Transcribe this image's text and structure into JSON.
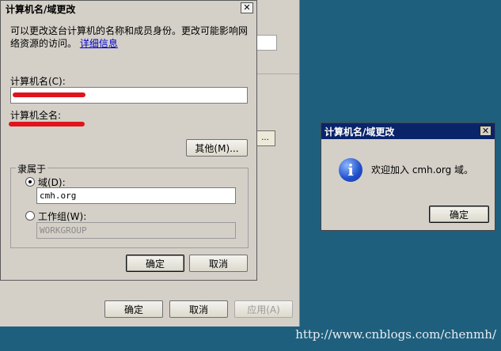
{
  "parent_window": {
    "ok_label": "确定",
    "cancel_label": "取消",
    "apply_label": "应用(A)",
    "small_button_label": "..."
  },
  "dialog": {
    "title": "计算机名/域更改",
    "close_glyph": "✕",
    "description": "可以更改这台计算机的名称和成员身份。更改可能影响网络资源的访问。",
    "details_link": "详细信息",
    "computer_name_label": "计算机名(C):",
    "computer_name_value": "",
    "full_name_label": "计算机全名:",
    "more_button": "其他(M)...",
    "member_of_label": "隶属于",
    "domain_label": "域(D):",
    "domain_value": "cmh.org",
    "workgroup_label": "工作组(W):",
    "workgroup_value": "WORKGROUP",
    "ok_label": "确定",
    "cancel_label": "取消"
  },
  "message_box": {
    "title": "计算机名/域更改",
    "close_glyph": "✕",
    "icon": "info-icon",
    "message": "欢迎加入 cmh.org 域。",
    "ok_label": "确定"
  },
  "watermark": "http://www.cnblogs.com/chenmh/",
  "colors": {
    "desktop": "#1f5f7e",
    "window_face": "#d4d0c8",
    "active_title": "#0a246a",
    "redaction": "#e0141c"
  }
}
